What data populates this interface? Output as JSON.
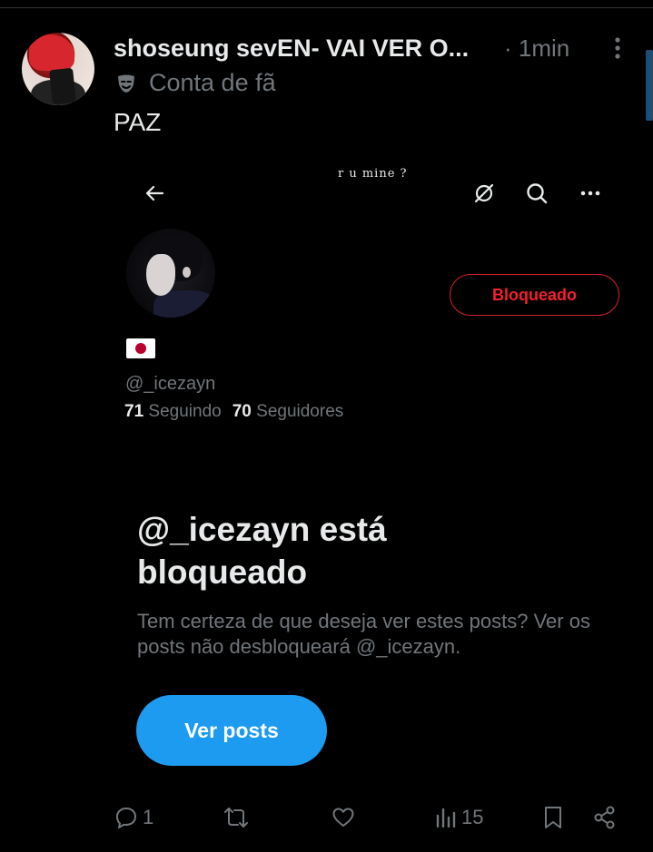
{
  "post": {
    "author_name": "shoseung sevEN- VAI VER O...",
    "time": "· 1min",
    "badge_label": "Conta de fã",
    "text": "PAZ"
  },
  "embed": {
    "title": "r u mine ?",
    "blocked_button": "Bloqueado",
    "handle": "@_icezayn",
    "following_count": "71",
    "following_label": "Seguindo",
    "followers_count": "70",
    "followers_label": "Seguidores",
    "blocked_title": "@_icezayn está bloqueado",
    "blocked_desc": "Tem certeza de que deseja ver estes posts? Ver os posts não desbloqueará @_icezayn.",
    "view_posts": "Ver posts"
  },
  "actions": {
    "replies": "1",
    "reposts": "",
    "likes": "",
    "views": "15"
  },
  "colors": {
    "accent": "#1d9bf0",
    "blocked_red": "#f4212e",
    "muted": "#71767b"
  }
}
